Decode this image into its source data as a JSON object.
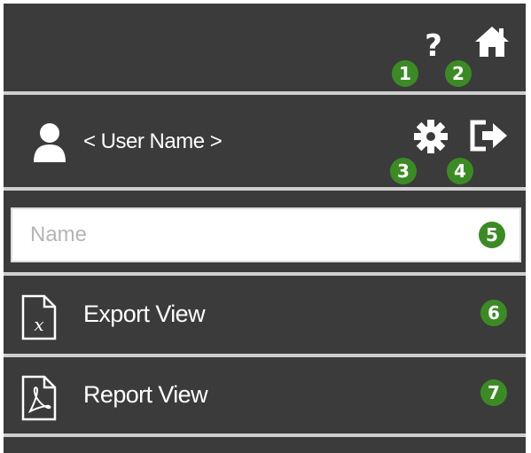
{
  "user": {
    "name": "< User Name >"
  },
  "search": {
    "placeholder": "Name",
    "value": ""
  },
  "menu": {
    "items": [
      {
        "label": "Export  View",
        "icon": "excel-file-icon"
      },
      {
        "label": "Report View",
        "icon": "pdf-file-icon"
      }
    ]
  },
  "toolbar": {
    "help_icon": "help-icon",
    "home_icon": "home-icon",
    "settings_icon": "gear-icon",
    "logout_icon": "logout-icon"
  },
  "callouts": [
    "1",
    "2",
    "3",
    "4",
    "5",
    "6",
    "7"
  ],
  "colors": {
    "panel": "#3b3b3b",
    "divider": "#cfcfcf",
    "badge": "#3c8a26",
    "text": "#ffffff"
  }
}
